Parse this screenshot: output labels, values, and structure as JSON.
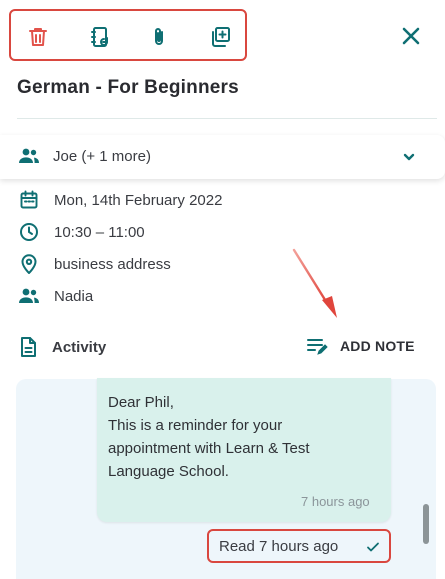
{
  "toolbar": {
    "icons": [
      "trash-icon",
      "reschedule-icon",
      "attachment-icon",
      "duplicate-icon"
    ],
    "close_icon": "close-icon",
    "highlight_color": "#d9473f",
    "icon_color": "#0f6f73",
    "delete_color": "#e2534b"
  },
  "appointment": {
    "title": "German - For Beginners",
    "attendees_label": "Joe (+ 1 more)",
    "date": "Mon, 14th February 2022",
    "time": "10:30 – 11:00",
    "location": "business address",
    "staff": "Nadia"
  },
  "activity": {
    "heading": "Activity",
    "add_note_label": "ADD NOTE",
    "message": {
      "lines": [
        "Dear Phil,",
        "This is a reminder for your",
        "appointment with Learn & Test",
        "Language School."
      ],
      "time": "7 hours ago",
      "read_status": "Read 7 hours ago"
    }
  },
  "colors": {
    "accent": "#0f6f73",
    "bubble": "#d9f1ec",
    "panel": "#eef6fb",
    "annotation": "#d9473f"
  }
}
